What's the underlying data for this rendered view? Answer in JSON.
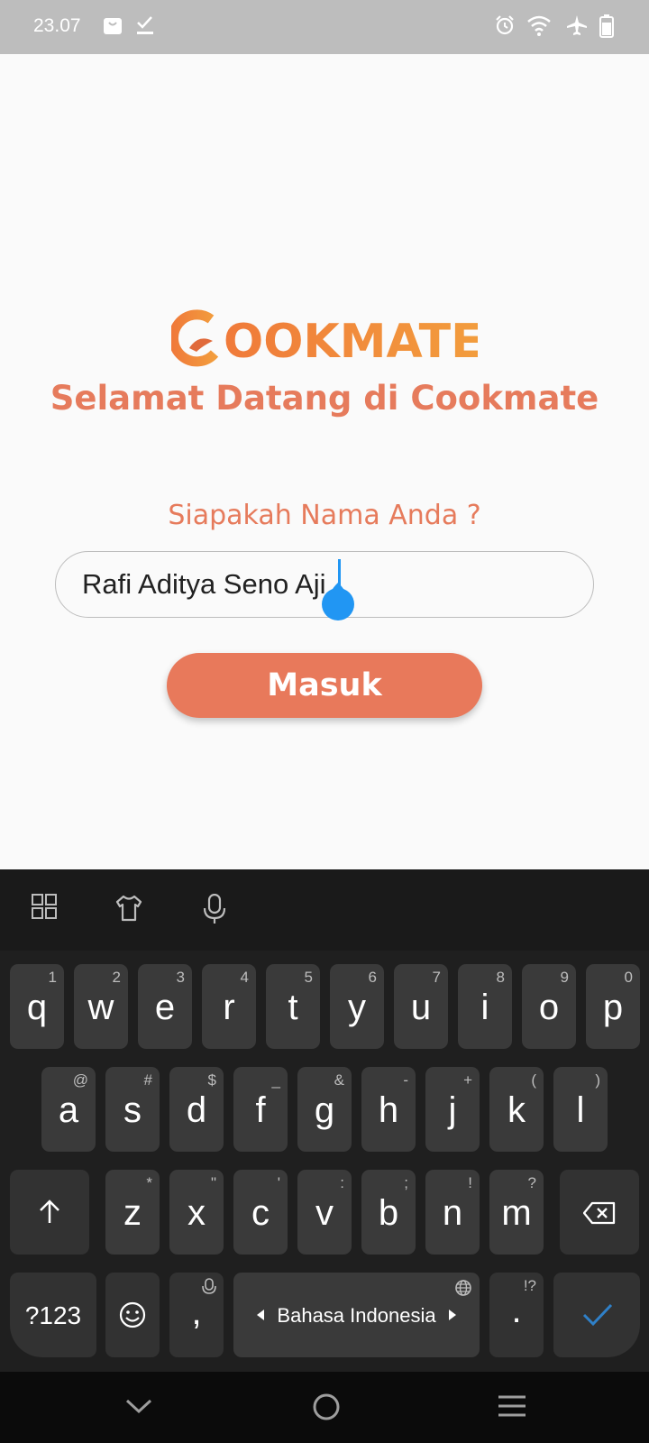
{
  "status_bar": {
    "time": "23.07"
  },
  "app": {
    "logo_text": "COOKMATE",
    "welcome": "Selamat Datang di Cookmate",
    "question": "Siapakah Nama Anda ?",
    "name_value": "Rafi Aditya Seno Aji",
    "submit_label": "Masuk"
  },
  "keyboard": {
    "toolbar_icons": [
      "grid-icon",
      "theme-shirt-icon",
      "microphone-icon"
    ],
    "row1": [
      {
        "k": "q",
        "h": "1"
      },
      {
        "k": "w",
        "h": "2"
      },
      {
        "k": "e",
        "h": "3"
      },
      {
        "k": "r",
        "h": "4"
      },
      {
        "k": "t",
        "h": "5"
      },
      {
        "k": "y",
        "h": "6"
      },
      {
        "k": "u",
        "h": "7"
      },
      {
        "k": "i",
        "h": "8"
      },
      {
        "k": "o",
        "h": "9"
      },
      {
        "k": "p",
        "h": "0"
      }
    ],
    "row2": [
      {
        "k": "a",
        "h": "@"
      },
      {
        "k": "s",
        "h": "#"
      },
      {
        "k": "d",
        "h": "$"
      },
      {
        "k": "f",
        "h": "_"
      },
      {
        "k": "g",
        "h": "&"
      },
      {
        "k": "h",
        "h": "-"
      },
      {
        "k": "j",
        "h": "+"
      },
      {
        "k": "k",
        "h": "("
      },
      {
        "k": "l",
        "h": ")"
      }
    ],
    "row3": [
      {
        "k": "z",
        "h": "*"
      },
      {
        "k": "x",
        "h": "\""
      },
      {
        "k": "c",
        "h": "'"
      },
      {
        "k": "v",
        "h": ":"
      },
      {
        "k": "b",
        "h": ";"
      },
      {
        "k": "n",
        "h": "!"
      },
      {
        "k": "m",
        "h": "?"
      }
    ],
    "symbols_label": "?123",
    "comma": ",",
    "space_label": "Bahasa Indonesia",
    "period": ".",
    "period_hint": "!?"
  },
  "colors": {
    "accent": "#e8795b",
    "logo": "#ef8a3c",
    "caret": "#2196f3",
    "keyboard_bg": "#1f1f1f",
    "key_bg": "#3a3a3a"
  }
}
